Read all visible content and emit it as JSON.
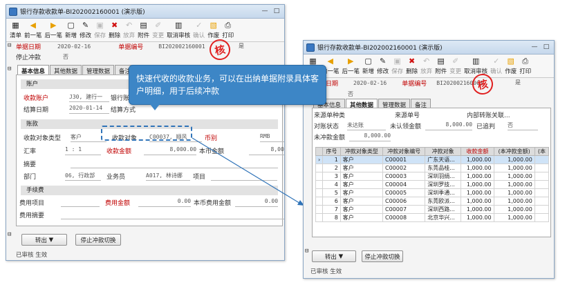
{
  "left": {
    "title": "银行存款收款单-BI202002160001 (演示版)",
    "toolbar": [
      "清单",
      "前一笔",
      "后一笔",
      "新增",
      "修改",
      "保存",
      "删除",
      "放弃",
      "附件",
      "变更",
      "取消审核",
      "确认",
      "作废",
      "打印"
    ],
    "header": {
      "date_label": "单据日期",
      "date_value": "2020-02-16",
      "no_label": "单据编号",
      "no_value": "BI202002160001",
      "offset_label": "停止冲款",
      "offset_value": "否",
      "yes_value": "是"
    },
    "tabs": [
      "基本信息",
      "其他数据",
      "管理数据",
      "备注"
    ],
    "sections": {
      "account": "账户",
      "money": "账款",
      "fee": "手续费"
    },
    "fields": {
      "recv_account_label": "收款账户",
      "recv_account_value": "J30, 建行一",
      "bank_label": "银行账号",
      "settle_date_label": "结算日期",
      "settle_date_value": "2020-01-14",
      "settle_method_label": "结算方式",
      "obj_type_label": "收款对象类型",
      "obj_type_value": "客户",
      "obj_label": "收款对象",
      "obj_value": "C00037, 顺风",
      "currency_label": "币别",
      "currency_value": "RMB",
      "rate_label": "汇率",
      "rate_value": "1 : 1",
      "amount_label": "收款金额",
      "amount_value": "8,000.00",
      "local_amount_label": "本币金额",
      "local_amount_value": "8,000.00",
      "summary_label": "摘要",
      "dept_label": "部门",
      "dept_value": "06, 行政部",
      "staff_label": "业务员",
      "staff_value": "A017, 林诗娜",
      "project_label": "项目",
      "fee_item_label": "费用项目",
      "fee_amount_label": "费用金额",
      "fee_amount_value": "0.00",
      "fee_local_label": "本币费用金额",
      "fee_local_value": "0.00",
      "fee_summary_label": "费用摘要"
    },
    "buttons": {
      "transfer": "转出",
      "stop": "停止冲款切换"
    },
    "status": "已审核 生效"
  },
  "tooltip": "快速代收的收款业务，可以在出纳单据附录具体客户明细，用于后续冲款",
  "stamp": "核",
  "right": {
    "title": "银行存款收款单-BI202002160001 (演示版)",
    "toolbar": [
      "清单",
      "前一笔",
      "后一笔",
      "新增",
      "修改",
      "保存",
      "删除",
      "放弃",
      "附件",
      "变更",
      "取消审核",
      "确认",
      "作废",
      "打印"
    ],
    "header": {
      "date_label": "单据日期",
      "date_value": "2020-02-16",
      "no_label": "单据编号",
      "no_value": "BI202002160001",
      "offset_label": "冲款",
      "offset_value": "否",
      "yes_value": "是"
    },
    "tabs": [
      "基本信息",
      "其他数据",
      "管理数据",
      "备注"
    ],
    "other": {
      "src_type_label": "来源单种类",
      "src_no_label": "来源单号",
      "internal_label": "内部转账关联...",
      "offset_status_label": "对账状态",
      "offset_status_value": "未达账",
      "unoffset_label": "未认领金额",
      "unoffset_value": "8,000.00",
      "recognized_label": "已追判",
      "recognized_value": "否",
      "unclaimed_label": "未冲款金额",
      "unclaimed_value": "8,000.00"
    },
    "grid": {
      "headers": [
        "序号",
        "冲款对象类型",
        "冲款对象编号",
        "冲款对象",
        "收款金额",
        "(本冲款金额)",
        "(本"
      ],
      "rows": [
        [
          "1",
          "客户",
          "C00001",
          "广东天语...",
          "1,000.00",
          "1,000.00"
        ],
        [
          "2",
          "客户",
          "C00002",
          "东莞品桂...",
          "1,000.00",
          "1,000.00"
        ],
        [
          "3",
          "客户",
          "C00003",
          "深圳羽绢...",
          "1,000.00",
          "1,000.00"
        ],
        [
          "4",
          "客户",
          "C00004",
          "深圳罗技...",
          "1,000.00",
          "1,000.00"
        ],
        [
          "5",
          "客户",
          "C00005",
          "深圳季通...",
          "1,000.00",
          "1,000.00"
        ],
        [
          "6",
          "客户",
          "C00006",
          "东莞欧派...",
          "1,000.00",
          "1,000.00"
        ],
        [
          "7",
          "客户",
          "C00007",
          "深圳西路...",
          "1,000.00",
          "1,000.00"
        ],
        [
          "8",
          "客户",
          "C00008",
          "北京华兴...",
          "1,000.00",
          "1,000.00"
        ]
      ]
    },
    "buttons": {
      "transfer": "转出",
      "stop": "停止冲款切换"
    },
    "status": "已审核 生效"
  },
  "colors": {
    "accent": "#3d86c6",
    "red_label": "#c00000",
    "stamp": "#e02020"
  }
}
